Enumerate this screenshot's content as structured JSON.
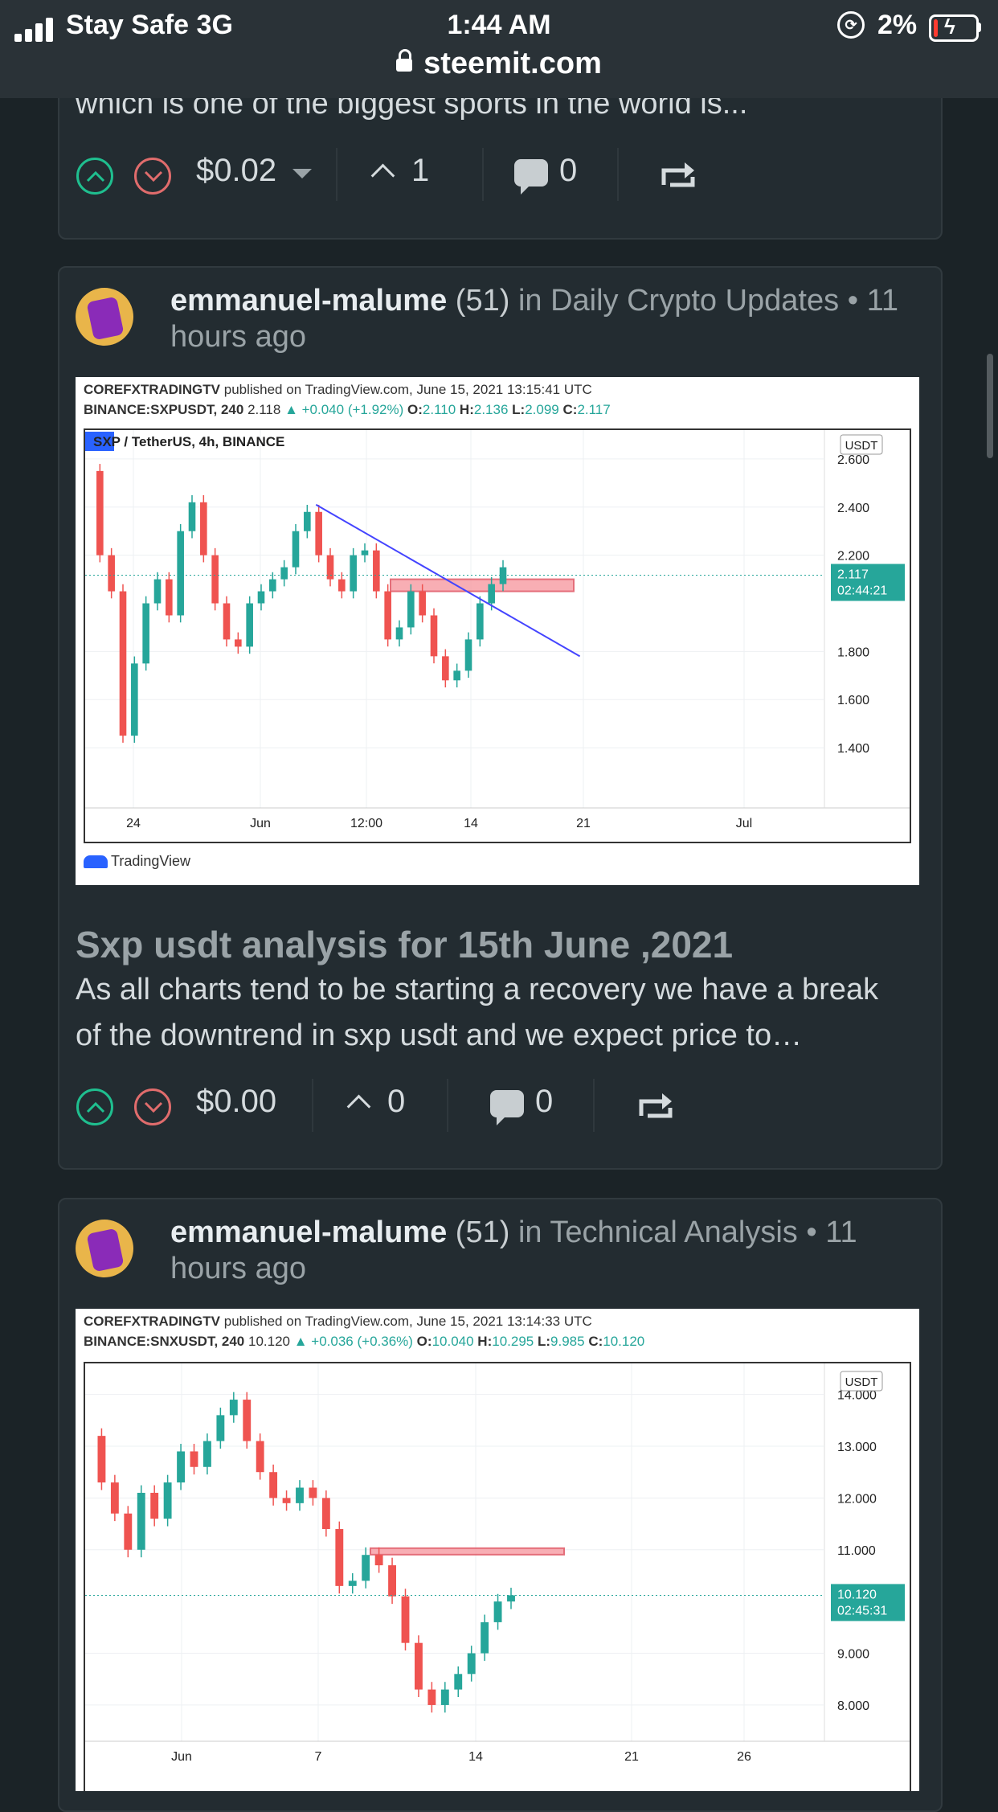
{
  "status_bar": {
    "carrier": "Stay Safe",
    "network": "3G",
    "time": "1:44 AM",
    "battery": "2%",
    "url": "steemit.com"
  },
  "prev_post": {
    "snippet": "which is one of the biggest sports in the world is...",
    "payout": "$0.02",
    "votes": "1",
    "comments": "0"
  },
  "posts": [
    {
      "author": "emmanuel-malume",
      "reputation": "(51)",
      "in_text": "in",
      "community": "Daily Crypto Updates",
      "dot": "•",
      "time": "11 hours ago",
      "chart_header_1_bold": "COREFXTRADINGTV",
      "chart_header_1_rest": "published on TradingView.com, June 15, 2021 13:15:41 UTC",
      "chart_header_2_sym": "BINANCE:SXPUSDT, 240",
      "chart_header_2_last": "2.118",
      "chart_header_2_change": "▲ +0.040 (+1.92%)",
      "chart_header_2_o": "2.110",
      "chart_header_2_h": "2.136",
      "chart_header_2_l": "2.099",
      "chart_header_2_c": "2.117",
      "chart_pair": "SXP / TetherUS, 4h, BINANCE",
      "chart_last_price": "2.117",
      "chart_countdown": "02:44:21",
      "title": "Sxp usdt analysis for 15th June ,2021",
      "body": "As all charts tend to be starting a recovery we have a break of the downtrend in sxp usdt and we expect price to…",
      "payout": "$0.00",
      "votes": "0",
      "comments": "0"
    },
    {
      "author": "emmanuel-malume",
      "reputation": "(51)",
      "in_text": "in",
      "community": "Technical Analysis",
      "dot": "•",
      "time": "11 hours ago",
      "chart_header_1_bold": "COREFXTRADINGTV",
      "chart_header_1_rest": "published on TradingView.com, June 15, 2021 13:14:33 UTC",
      "chart_header_2_sym": "BINANCE:SNXUSDT, 240",
      "chart_header_2_last": "10.120",
      "chart_header_2_change": "▲ +0.036 (+0.36%)",
      "chart_header_2_o": "10.040",
      "chart_header_2_h": "10.295",
      "chart_header_2_l": "9.985",
      "chart_header_2_c": "10.120",
      "chart_last_price": "10.120",
      "chart_countdown": "02:45:31"
    }
  ],
  "labels": {
    "o": "O:",
    "h": "H:",
    "l": "L:",
    "c": "C:",
    "currency": "USDT",
    "tradingview": "TradingView"
  },
  "chart_data": [
    {
      "type": "line",
      "title": "SXP / TetherUS, 4h, BINANCE",
      "x_ticks": [
        "24",
        "Jun",
        "12:00",
        "14",
        "21",
        "Jul"
      ],
      "y_ticks": [
        "2.600",
        "2.400",
        "2.200",
        "1.800",
        "1.600",
        "1.400"
      ],
      "ylim": [
        1.25,
        2.72
      ],
      "series": [
        {
          "values": [
            2.55,
            2.2,
            2.05,
            1.45,
            1.75,
            2.0,
            2.1,
            1.95,
            2.3,
            2.42,
            2.2,
            2.0,
            1.85,
            1.82,
            2.0,
            2.05,
            2.1,
            2.15,
            2.3,
            2.38,
            2.2,
            2.1,
            2.05,
            2.2,
            2.22,
            2.05,
            1.85,
            1.9,
            2.05,
            1.95,
            1.78,
            1.68,
            1.72,
            1.85,
            2.0,
            2.08,
            2.15
          ]
        }
      ],
      "current_price": 2.117,
      "trendline": [
        [
          0.28,
          2.41
        ],
        [
          0.6,
          1.78
        ]
      ],
      "resistance_zone": [
        2.05,
        2.1
      ]
    },
    {
      "type": "line",
      "x_ticks": [
        "Jun",
        "7",
        "14",
        "21",
        "26"
      ],
      "y_ticks": [
        "14.000",
        "13.000",
        "12.000",
        "11.000",
        "9.000",
        "8.000"
      ],
      "ylim": [
        7.3,
        14.6
      ],
      "series": [
        {
          "values": [
            13.2,
            12.3,
            11.7,
            11.0,
            12.1,
            11.6,
            12.3,
            12.9,
            12.6,
            13.1,
            13.6,
            13.9,
            13.1,
            12.5,
            12.0,
            11.9,
            12.2,
            12.0,
            11.4,
            10.3,
            10.4,
            10.9,
            10.7,
            10.1,
            9.2,
            8.3,
            8.0,
            8.3,
            8.6,
            9.0,
            9.6,
            10.0,
            10.12
          ]
        }
      ],
      "current_price": 10.12,
      "resistance_zone": [
        10.93,
        11.03
      ]
    }
  ]
}
